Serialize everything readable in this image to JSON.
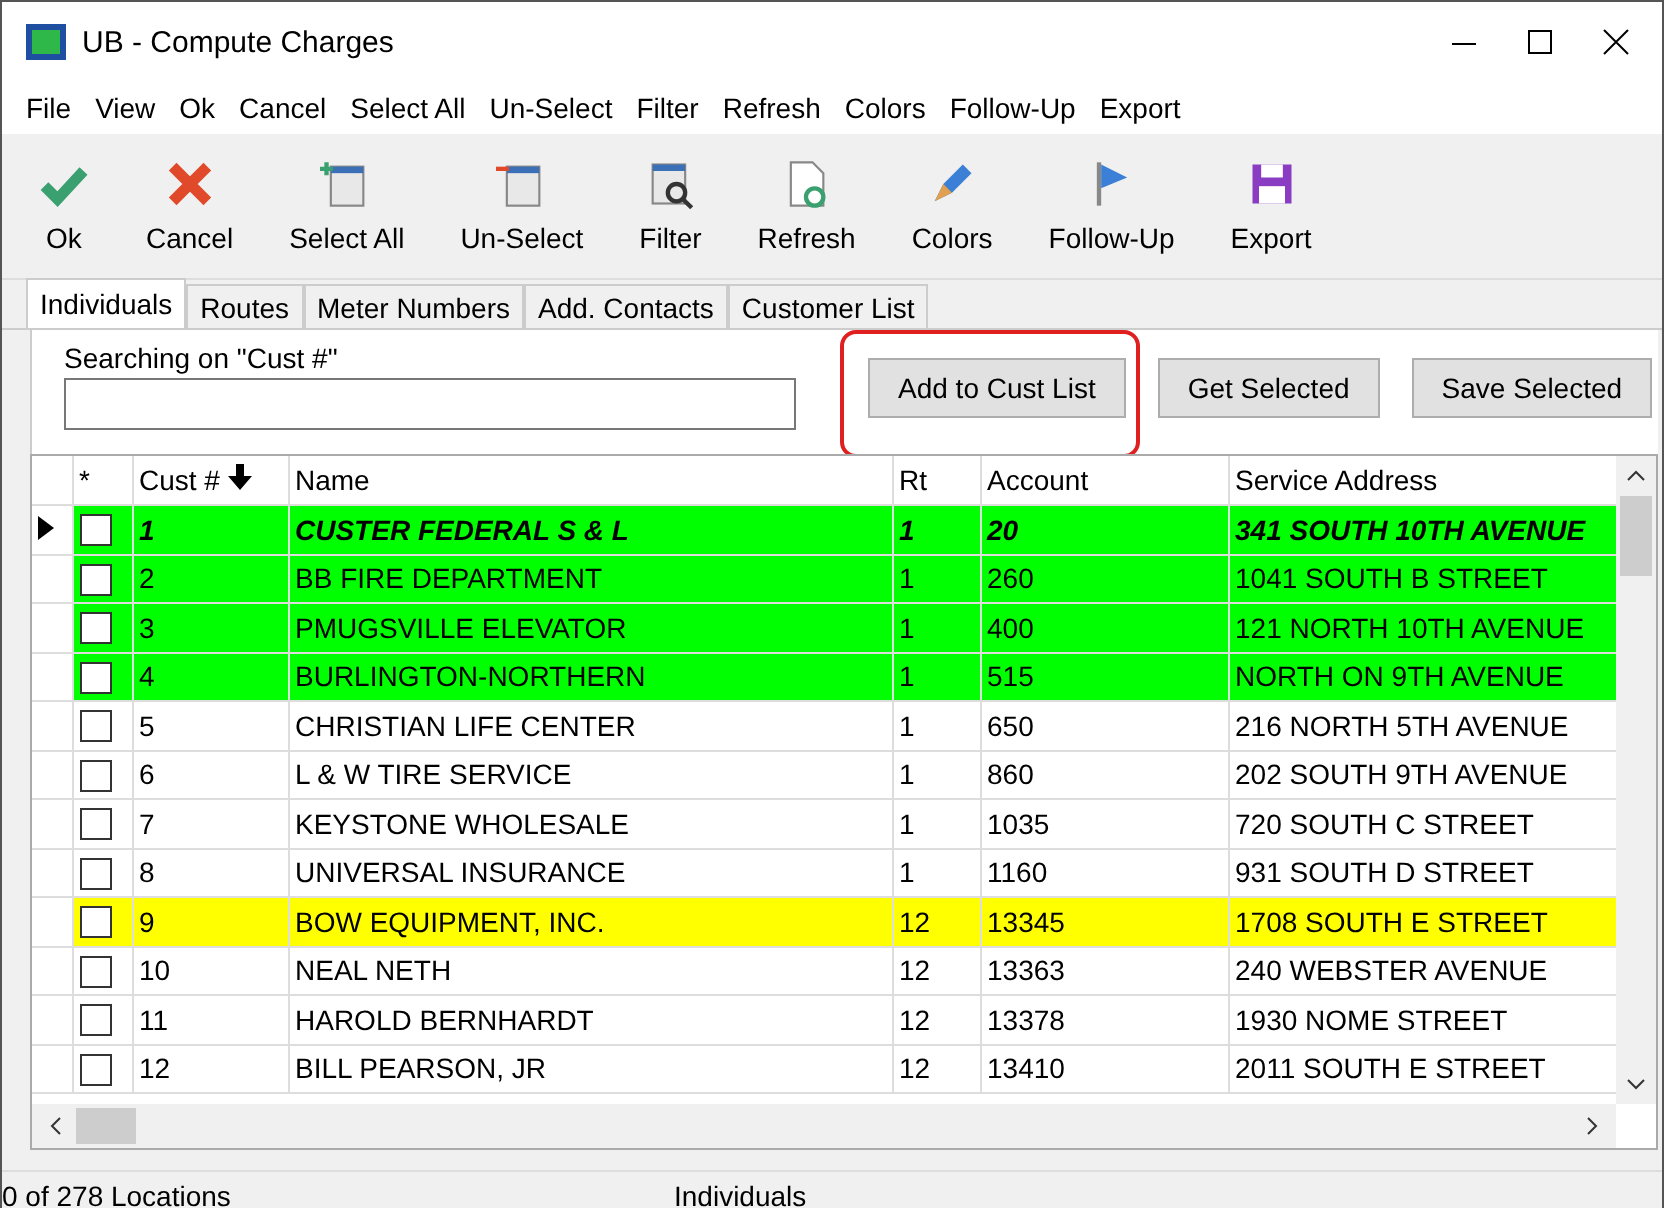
{
  "window": {
    "title": "UB - Compute Charges"
  },
  "menu": [
    "File",
    "View",
    "Ok",
    "Cancel",
    "Select All",
    "Un-Select",
    "Filter",
    "Refresh",
    "Colors",
    "Follow-Up",
    "Export"
  ],
  "toolbar": [
    {
      "kind": "ok",
      "label": "Ok"
    },
    {
      "kind": "cancel",
      "label": "Cancel"
    },
    {
      "kind": "selectall",
      "label": "Select All"
    },
    {
      "kind": "unselect",
      "label": "Un-Select"
    },
    {
      "kind": "filter",
      "label": "Filter"
    },
    {
      "kind": "refresh",
      "label": "Refresh"
    },
    {
      "kind": "colors",
      "label": "Colors"
    },
    {
      "kind": "followup",
      "label": "Follow-Up"
    },
    {
      "kind": "export",
      "label": "Export"
    }
  ],
  "tabs": [
    {
      "label": "Individuals",
      "selected": true
    },
    {
      "label": "Routes",
      "selected": false
    },
    {
      "label": "Meter Numbers",
      "selected": false
    },
    {
      "label": "Add. Contacts",
      "selected": false
    },
    {
      "label": "Customer List",
      "selected": false
    }
  ],
  "search": {
    "label": "Searching on \"Cust #\""
  },
  "buttons": [
    {
      "label": "Add to Cust List",
      "highlighted": true
    },
    {
      "label": "Get Selected",
      "highlighted": false
    },
    {
      "label": "Save Selected",
      "highlighted": false
    }
  ],
  "table": {
    "check_column_header": "*",
    "columns": [
      "Cust #",
      "Name",
      "Rt",
      "Account",
      "Service Address"
    ],
    "rows": [
      {
        "current": true,
        "checked": false,
        "color": "#00ff00",
        "cells": [
          "1",
          "CUSTER FEDERAL S & L",
          "1",
          "20",
          "341 SOUTH 10TH AVENUE"
        ]
      },
      {
        "current": false,
        "checked": false,
        "color": "#00ff00",
        "cells": [
          "2",
          "BB FIRE DEPARTMENT",
          "1",
          "260",
          "1041 SOUTH B STREET"
        ]
      },
      {
        "current": false,
        "checked": false,
        "color": "#00ff00",
        "cells": [
          "3",
          "PMUGSVILLE ELEVATOR",
          "1",
          "400",
          "121 NORTH 10TH AVENUE"
        ]
      },
      {
        "current": false,
        "checked": false,
        "color": "#00ff00",
        "cells": [
          "4",
          "BURLINGTON-NORTHERN",
          "1",
          "515",
          "NORTH ON 9TH AVENUE"
        ]
      },
      {
        "current": false,
        "checked": false,
        "color": "#ffffff",
        "cells": [
          "5",
          "CHRISTIAN LIFE CENTER",
          "1",
          "650",
          "216 NORTH 5TH AVENUE"
        ]
      },
      {
        "current": false,
        "checked": false,
        "color": "#ffffff",
        "cells": [
          "6",
          "L & W TIRE SERVICE",
          "1",
          "860",
          "202 SOUTH 9TH AVENUE"
        ]
      },
      {
        "current": false,
        "checked": false,
        "color": "#ffffff",
        "cells": [
          "7",
          "KEYSTONE WHOLESALE",
          "1",
          "1035",
          "720 SOUTH C STREET"
        ]
      },
      {
        "current": false,
        "checked": false,
        "color": "#ffffff",
        "cells": [
          "8",
          "UNIVERSAL INSURANCE",
          "1",
          "1160",
          "931 SOUTH D STREET"
        ]
      },
      {
        "current": false,
        "checked": false,
        "color": "#ffff00",
        "cells": [
          "9",
          "BOW EQUIPMENT, INC.",
          "12",
          "13345",
          "1708 SOUTH E STREET"
        ]
      },
      {
        "current": false,
        "checked": false,
        "color": "#ffffff",
        "cells": [
          "10",
          "NEAL NETH",
          "12",
          "13363",
          "240 WEBSTER AVENUE"
        ]
      },
      {
        "current": false,
        "checked": false,
        "color": "#ffffff",
        "cells": [
          "11",
          "HAROLD BERNHARDT",
          "12",
          "13378",
          "1930 NOME STREET"
        ]
      },
      {
        "current": false,
        "checked": false,
        "color": "#ffffff",
        "cells": [
          "12",
          "BILL PEARSON, JR",
          "12",
          "13410",
          "2011 SOUTH E STREET"
        ]
      }
    ]
  },
  "status_bar": [
    "0 of 278 Locations",
    "Individuals"
  ]
}
